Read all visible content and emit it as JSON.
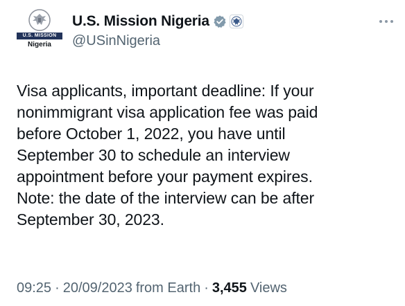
{
  "account": {
    "display_name": "U.S. Mission Nigeria",
    "handle": "@USinNigeria",
    "avatar_band_text": "U.S. MISSION",
    "avatar_sub_text": "Nigeria",
    "avatar_icon": "eagle-seal-icon",
    "verified_icon": "verified-badge-icon",
    "affiliate_icon": "government-seal-icon"
  },
  "more_icon": "more-options-icon",
  "tweet": {
    "lines": [
      "Visa applicants, important deadline: If your",
      "nonimmigrant visa application fee was paid",
      "before October 1, 2022, you have until",
      "September 30 to schedule an interview",
      "appointment before your payment expires.",
      "Note: the date of the interview can be after",
      "September 30, 2023."
    ]
  },
  "meta": {
    "time": "09:25",
    "separator": "·",
    "date": "20/09/2023",
    "source": "from Earth",
    "views_count": "3,455",
    "views_label": "Views"
  },
  "colors": {
    "text_primary": "#0f1419",
    "text_secondary": "#536471",
    "verified_badge": "#829aab",
    "avatar_band": "#22335a"
  }
}
